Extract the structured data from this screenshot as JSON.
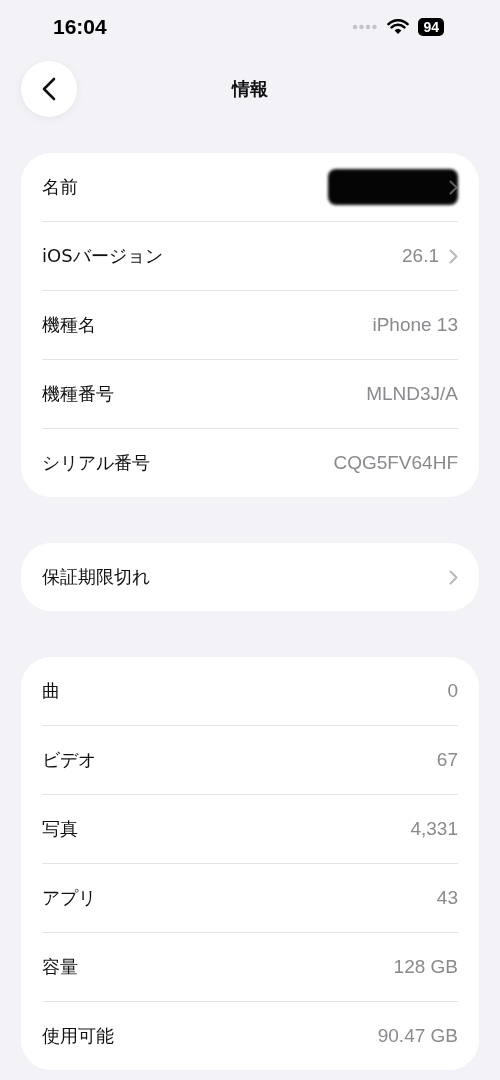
{
  "status_bar": {
    "time": "16:04",
    "battery": "94"
  },
  "nav": {
    "title": "情報"
  },
  "groups": [
    {
      "rows": [
        {
          "label": "名前",
          "redacted": true,
          "chevron": true
        },
        {
          "label": "iOSバージョン",
          "value": "26.1",
          "redacted": false,
          "chevron": true
        },
        {
          "label": "機種名",
          "value": "iPhone 13",
          "redacted": false,
          "chevron": false
        },
        {
          "label": "機種番号",
          "value": "MLND3J/A",
          "redacted": false,
          "chevron": false
        },
        {
          "label": "シリアル番号",
          "value": "CQG5FV64HF",
          "redacted": false,
          "chevron": false
        }
      ]
    },
    {
      "rows": [
        {
          "label": "保証期限切れ",
          "redacted": false,
          "chevron": true
        }
      ]
    },
    {
      "rows": [
        {
          "label": "曲",
          "value": "0",
          "redacted": false,
          "chevron": false
        },
        {
          "label": "ビデオ",
          "value": "67",
          "redacted": false,
          "chevron": false
        },
        {
          "label": "写真",
          "value": "4,331",
          "redacted": false,
          "chevron": false
        },
        {
          "label": "アプリ",
          "value": "43",
          "redacted": false,
          "chevron": false
        },
        {
          "label": "容量",
          "value": "128 GB",
          "redacted": false,
          "chevron": false
        },
        {
          "label": "使用可能",
          "value": "90.47 GB",
          "redacted": false,
          "chevron": false
        }
      ]
    }
  ]
}
